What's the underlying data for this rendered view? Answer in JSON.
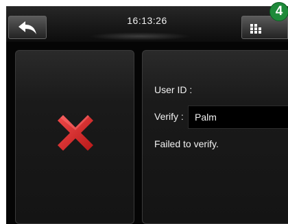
{
  "header": {
    "time": "16:13:26",
    "badge": "4",
    "back_icon": "back-arrow-icon",
    "menu_icon": "grid-menu-icon"
  },
  "result": {
    "status_icon": "fail-cross-icon",
    "status_color": "#d92b2b"
  },
  "details": {
    "user_id_label": "User ID :",
    "verify_label": "Verify :",
    "verify_value": "Palm",
    "message": "Failed to verify."
  }
}
